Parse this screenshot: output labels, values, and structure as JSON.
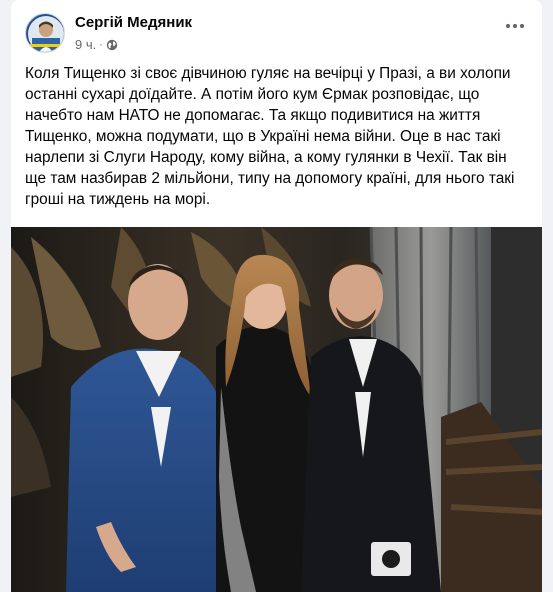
{
  "post": {
    "author": "Сергій Медяник",
    "time": "9 ч.",
    "separator": "·",
    "audience_icon": "globe-icon",
    "more_icon": "more-horizontal-icon",
    "text": "Коля Тищенко зі своє дівчиною гуляє на вечірці у Празі, а ви холопи останні сухарі доїдайте. А потім його кум Єрмак розповідає, що начебто нам НАТО не допомагає. Та якщо подивитися на життя Тищенко, можна подумати, що в Україні нема війни. Оце в нас такі нарлепи зі Слуги Народу, кому війна, а кому гулянки в Чехії. Так він ще там назбирав 2 мільйони, типу на допомогу країні, для нього такі гроші на тиждень на морі."
  },
  "colors": {
    "page_bg": "#f0f2f5",
    "card_bg": "#ffffff",
    "text_primary": "#050505",
    "text_secondary": "#65676b"
  }
}
